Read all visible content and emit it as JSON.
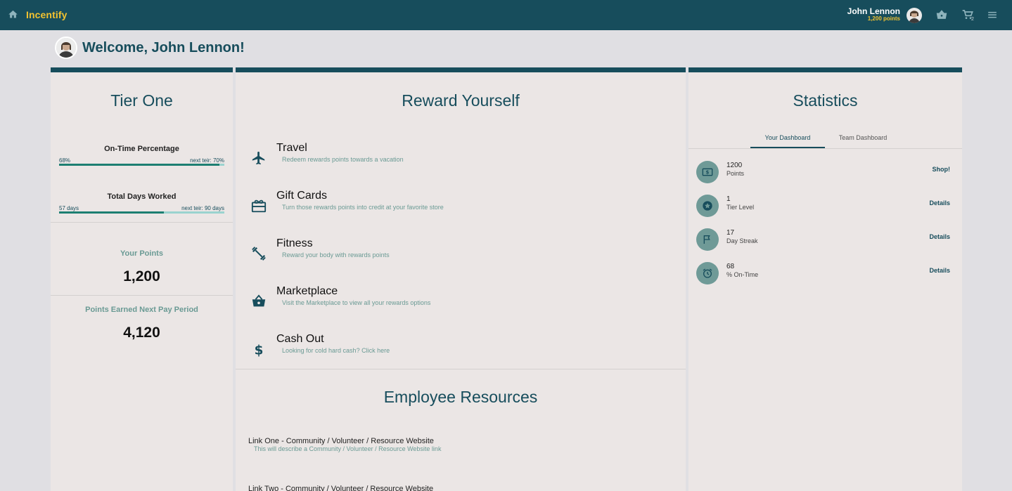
{
  "header": {
    "brand": "Incentify",
    "user_name": "John Lennon",
    "user_points": "1,200 points",
    "cart_count": "2",
    "home_icon": "home-icon",
    "basket_icon": "basket-icon",
    "cart_icon": "cart-icon",
    "menu_icon": "menu-icon"
  },
  "welcome": "Welcome, John Lennon!",
  "tier": {
    "title": "Tier One",
    "metrics": [
      {
        "label": "On-Time Percentage",
        "current": "68%",
        "next": "next teir: 70%",
        "progress": 0.97
      },
      {
        "label": "Total Days Worked",
        "current": "57 days",
        "next": "next teir: 90 days",
        "progress": 0.633
      }
    ],
    "your_points_label": "Your Points",
    "your_points_value": "1,200",
    "next_period_label": "Points Earned Next Pay Period",
    "next_period_value": "4,120"
  },
  "rewards": {
    "title": "Reward Yourself",
    "items": [
      {
        "name": "Travel",
        "desc": "Redeem rewards points towards a vacation",
        "icon": "airplane-icon"
      },
      {
        "name": "Gift Cards",
        "desc": "Turn those rewards points into credit at your favorite store",
        "icon": "gift-card-icon"
      },
      {
        "name": "Fitness",
        "desc": "Reward your body with rewards points",
        "icon": "dumbbell-icon"
      },
      {
        "name": "Marketplace",
        "desc": "Visit the Marketplace to view all your rewards options",
        "icon": "basket-icon"
      },
      {
        "name": "Cash Out",
        "desc": "Looking for cold hard cash? Click here",
        "icon": "dollar-icon"
      }
    ]
  },
  "resources": {
    "title": "Employee Resources",
    "links": [
      {
        "label": "Link One - Community / Volunteer / Resource Website",
        "desc": "This will describe a Community / Volunteer / Resource Website link"
      },
      {
        "label": "Link Two - Community / Volunteer / Resource Website",
        "desc": ""
      }
    ]
  },
  "stats": {
    "title": "Statistics",
    "tabs": [
      "Your Dashboard",
      "Team Dashboard"
    ],
    "active_tab": "Your Dashboard",
    "rows": [
      {
        "value": "1200",
        "label": "Points",
        "action": "Shop!",
        "icon": "dollar-bill-icon"
      },
      {
        "value": "1",
        "label": "Tier Level",
        "action": "Details",
        "icon": "star-badge-icon"
      },
      {
        "value": "17",
        "label": "Day Streak",
        "action": "Details",
        "icon": "flag-icon"
      },
      {
        "value": "68",
        "label": "% On-Time",
        "action": "Details",
        "icon": "alarm-clock-icon"
      }
    ]
  },
  "colors": {
    "header_bg": "#174d5c",
    "accent_gold": "#f2c230",
    "panel_bg": "#ebe6e5",
    "page_bg": "#e0dfe3",
    "progress_fill": "#1d7f72",
    "progress_track": "#9ad3cf",
    "muted_teal": "#6a9a94"
  }
}
